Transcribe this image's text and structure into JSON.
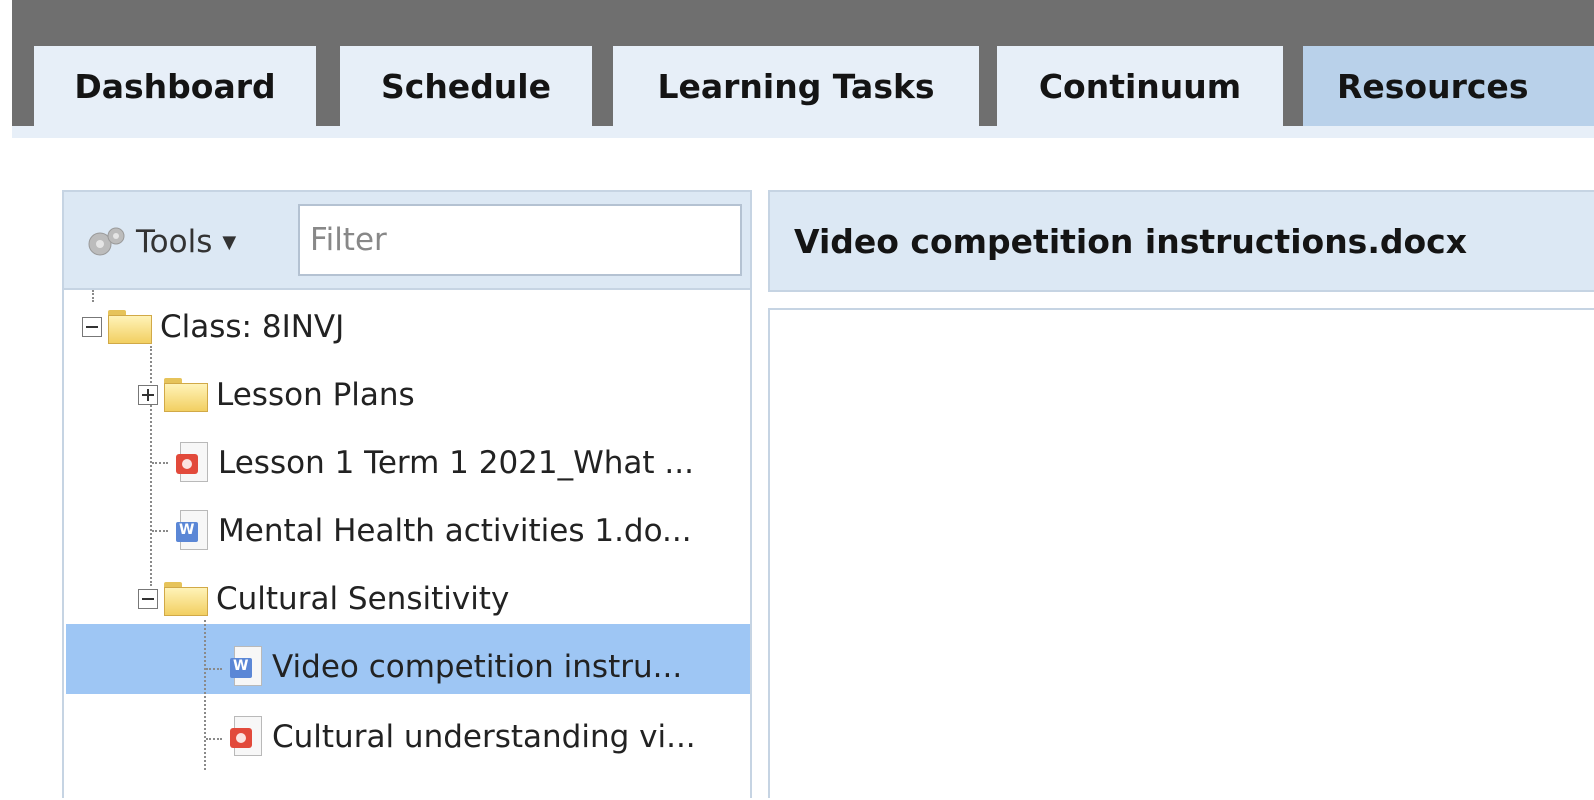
{
  "tabs": [
    {
      "label": "Dashboard",
      "active": false
    },
    {
      "label": "Schedule",
      "active": false
    },
    {
      "label": "Learning Tasks",
      "active": false
    },
    {
      "label": "Continuum",
      "active": false
    },
    {
      "label": "Resources",
      "active": true
    }
  ],
  "toolbar": {
    "tools_label": "Tools",
    "tools_icon": "gear-icon",
    "filter_placeholder": "Filter"
  },
  "tree": {
    "root": {
      "label": "Class: 8INVJ",
      "icon": "folder-icon",
      "expanded": true
    },
    "items": [
      {
        "label": "Lesson Plans",
        "icon": "folder-icon",
        "expanded": false
      },
      {
        "label": "Lesson 1 Term 1 2021_What ...",
        "icon": "powerpoint-icon"
      },
      {
        "label": "Mental Health activities 1.do...",
        "icon": "word-doc-icon"
      },
      {
        "label": "Cultural Sensitivity",
        "icon": "folder-icon",
        "expanded": true
      },
      {
        "label": "Video competition instru...",
        "icon": "word-doc-icon",
        "selected": true
      },
      {
        "label": "Cultural understanding vi...",
        "icon": "powerpoint-icon"
      }
    ]
  },
  "document": {
    "title": "Video competition instructions.docx"
  },
  "colors": {
    "topbar": "#6f6f6f",
    "tab_bg": "#e7eff8",
    "tab_active_bg": "#b9d1ea",
    "panel_header_bg": "#dce8f4",
    "selection_bg": "#9ec6f4"
  }
}
